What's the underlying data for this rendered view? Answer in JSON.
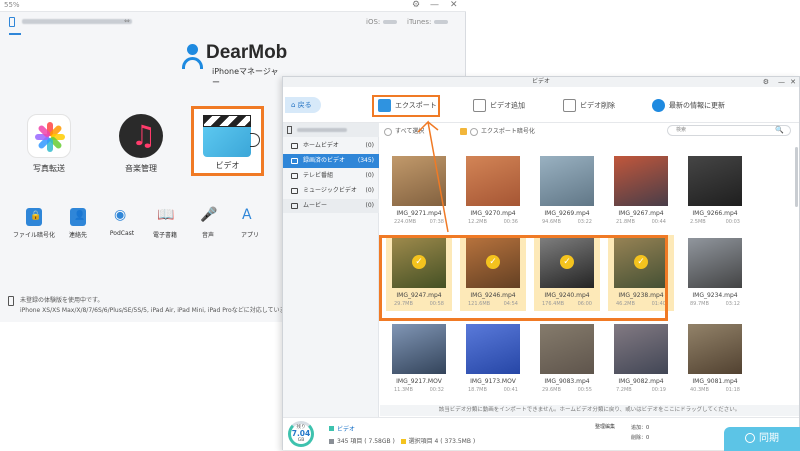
{
  "main_window": {
    "battery": "55%",
    "controls": {
      "settings": "⚙",
      "minimize": "—",
      "close": "✕"
    },
    "device_sep": "⇔",
    "ios_label": "iOS:",
    "itunes_label": "iTunes:",
    "brand": "DearMob",
    "subtitle": "iPhoneマネージャー",
    "big_apps": [
      {
        "label": "写真転送",
        "icon": "photos-icon"
      },
      {
        "label": "音楽管理",
        "icon": "music-icon"
      },
      {
        "label": "ビデオ",
        "icon": "clapperboard-icon"
      }
    ],
    "small_apps": [
      {
        "label": "ファイル暗号化",
        "glyph": "🔒"
      },
      {
        "label": "連絡先",
        "glyph": "👤"
      },
      {
        "label": "PodCast",
        "glyph": "◉"
      },
      {
        "label": "電子書籍",
        "glyph": "📖"
      },
      {
        "label": "音声",
        "glyph": "🎤"
      },
      {
        "label": "アプリ",
        "glyph": "A"
      }
    ],
    "status_line1": "未登録の体験版を使用中です。",
    "status_line2": "iPhone XS/XS Max/X/8/7/6S/6/Plus/SE/5S/5, iPad Air, iPad Mini, iPad Proなどに対応していま"
  },
  "video_window": {
    "title": "ビデオ",
    "controls": {
      "settings": "⚙",
      "minimize": "—",
      "close": "✕"
    },
    "back_label": "戻る",
    "toolbar": [
      {
        "label": "エクスポート",
        "icon": "export-icon"
      },
      {
        "label": "ビデオ追加",
        "icon": "add-video-icon"
      },
      {
        "label": "ビデオ削除",
        "icon": "delete-video-icon"
      },
      {
        "label": "最新の情報に更新",
        "icon": "refresh-icon"
      }
    ],
    "sidebar": [
      {
        "label": "ホームビデオ",
        "count": "(0)"
      },
      {
        "label": "録画済のビデオ",
        "count": "(345)"
      },
      {
        "label": "テレビ番組",
        "count": "(0)"
      },
      {
        "label": "ミュージックビデオ",
        "count": "(0)"
      },
      {
        "label": "ムービー",
        "count": "(0)"
      }
    ],
    "select_all": "すべて選択",
    "export_encrypt": "エクスポート暗号化",
    "search_placeholder": "検索",
    "search_icon": "🔍",
    "check_mark": "✓",
    "videos": [
      {
        "name": "IMG_9271.mp4",
        "size": "224.0MB",
        "dur": "07:38",
        "selected": false,
        "c1": "#7a5a3a",
        "c2": "#c9a070"
      },
      {
        "name": "IMG_9270.mp4",
        "size": "12.2MB",
        "dur": "00:36",
        "selected": false,
        "c1": "#a05030",
        "c2": "#d88a5a"
      },
      {
        "name": "IMG_9269.mp4",
        "size": "94.6MB",
        "dur": "03:22",
        "selected": false,
        "c1": "#5a7080",
        "c2": "#a0b8c8"
      },
      {
        "name": "IMG_9267.mp4",
        "size": "21.8MB",
        "dur": "00:44",
        "selected": false,
        "c1": "#3a3a4a",
        "c2": "#d05a3a"
      },
      {
        "name": "IMG_9266.mp4",
        "size": "2.5MB",
        "dur": "00:03",
        "selected": false,
        "c1": "#1a1a1a",
        "c2": "#4a4a4a"
      },
      {
        "name": "IMG_9247.mp4",
        "size": "29.7MB",
        "dur": "00:58",
        "selected": true,
        "c1": "#3a4a20",
        "c2": "#a89050"
      },
      {
        "name": "IMG_9246.mp4",
        "size": "121.6MB",
        "dur": "04:54",
        "selected": true,
        "c1": "#5a3a20",
        "c2": "#c07840"
      },
      {
        "name": "IMG_9240.mp4",
        "size": "176.4MB",
        "dur": "06:00",
        "selected": true,
        "c1": "#1a1a1a",
        "c2": "#888888"
      },
      {
        "name": "IMG_9238.mp4",
        "size": "46.2MB",
        "dur": "01:40",
        "selected": true,
        "c1": "#3a4a30",
        "c2": "#a08858"
      },
      {
        "name": "IMG_9234.mp4",
        "size": "89.7MB",
        "dur": "03:12",
        "selected": false,
        "c1": "#3a3a3a",
        "c2": "#9aa0a8"
      },
      {
        "name": "IMG_9217.MOV",
        "size": "11.3MB",
        "dur": "00:32",
        "selected": false,
        "c1": "#2a3a50",
        "c2": "#8aa0c0"
      },
      {
        "name": "IMG_9173.MOV",
        "size": "18.7MB",
        "dur": "00:41",
        "selected": false,
        "c1": "#2040a0",
        "c2": "#6080e0"
      },
      {
        "name": "IMG_9083.mp4",
        "size": "29.6MB",
        "dur": "00:55",
        "selected": false,
        "c1": "#5a5048",
        "c2": "#8a8070"
      },
      {
        "name": "IMG_9082.mp4",
        "size": "7.2MB",
        "dur": "00:19",
        "selected": false,
        "c1": "#3a4050",
        "c2": "#8a8088"
      },
      {
        "name": "IMG_9081.mp4",
        "size": "40.3MB",
        "dur": "01:18",
        "selected": false,
        "c1": "#4a3a2a",
        "c2": "#9a8a70"
      }
    ],
    "drop_hint": "該当ビデオ分類に動画をインポートできません。ホームビデオ分類に戻り、或いはビデオをここにドラッグしてください。",
    "footer": {
      "storage_label": "残り",
      "storage_value": "7.04",
      "storage_unit": "GB",
      "category": "ビデオ",
      "total": "345 項目 ( 7.58GB )",
      "selected": "選択項目 4 ( 373.5MB )",
      "mid_label": "整理編集",
      "add_label": "追加：0",
      "delete_label": "削除：0",
      "sync_label": "同期"
    }
  }
}
